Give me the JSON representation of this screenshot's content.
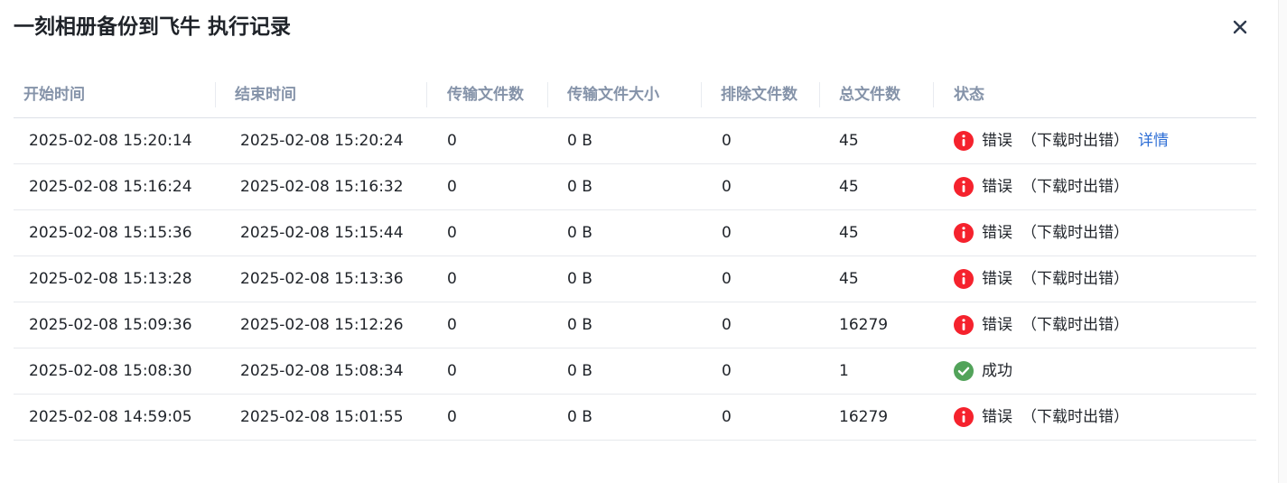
{
  "dialog": {
    "title": "一刻相册备份到飞牛 执行记录",
    "close_icon": "close-icon"
  },
  "table": {
    "columns": [
      "开始时间",
      "结束时间",
      "传输文件数",
      "传输文件大小",
      "排除文件数",
      "总文件数",
      "状态"
    ],
    "rows": [
      {
        "start": "2025-02-08 15:20:14",
        "end": "2025-02-08 15:20:24",
        "transferred": "0",
        "size": "0 B",
        "excluded": "0",
        "total": "45",
        "status": "错误",
        "reason": "（下载时出错）",
        "detail": "详情",
        "status_type": "error"
      },
      {
        "start": "2025-02-08 15:16:24",
        "end": "2025-02-08 15:16:32",
        "transferred": "0",
        "size": "0 B",
        "excluded": "0",
        "total": "45",
        "status": "错误",
        "reason": "（下载时出错）",
        "detail": "",
        "status_type": "error"
      },
      {
        "start": "2025-02-08 15:15:36",
        "end": "2025-02-08 15:15:44",
        "transferred": "0",
        "size": "0 B",
        "excluded": "0",
        "total": "45",
        "status": "错误",
        "reason": "（下载时出错）",
        "detail": "",
        "status_type": "error"
      },
      {
        "start": "2025-02-08 15:13:28",
        "end": "2025-02-08 15:13:36",
        "transferred": "0",
        "size": "0 B",
        "excluded": "0",
        "total": "45",
        "status": "错误",
        "reason": "（下载时出错）",
        "detail": "",
        "status_type": "error"
      },
      {
        "start": "2025-02-08 15:09:36",
        "end": "2025-02-08 15:12:26",
        "transferred": "0",
        "size": "0 B",
        "excluded": "0",
        "total": "16279",
        "status": "错误",
        "reason": "（下载时出错）",
        "detail": "",
        "status_type": "error"
      },
      {
        "start": "2025-02-08 15:08:30",
        "end": "2025-02-08 15:08:34",
        "transferred": "0",
        "size": "0 B",
        "excluded": "0",
        "total": "1",
        "status": "成功",
        "reason": "",
        "detail": "",
        "status_type": "success"
      },
      {
        "start": "2025-02-08 14:59:05",
        "end": "2025-02-08 15:01:55",
        "transferred": "0",
        "size": "0 B",
        "excluded": "0",
        "total": "16279",
        "status": "错误",
        "reason": "（下载时出错）",
        "detail": "",
        "status_type": "error"
      }
    ]
  },
  "colors": {
    "error": "#f5222d",
    "success": "#52a35a",
    "link": "#2f6fd6",
    "header_text": "#8593a9"
  }
}
